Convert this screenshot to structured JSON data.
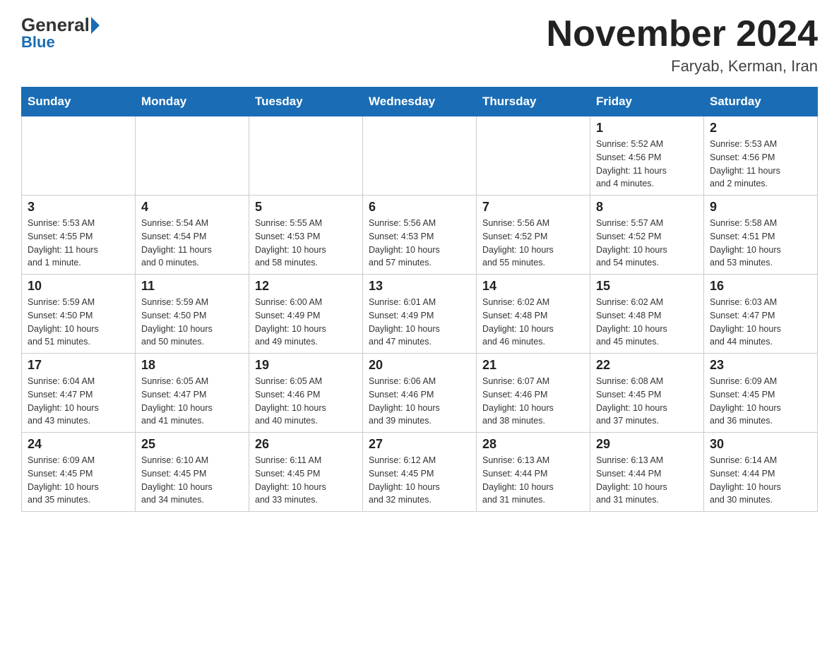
{
  "header": {
    "logo_general": "General",
    "logo_blue": "Blue",
    "title": "November 2024",
    "subtitle": "Faryab, Kerman, Iran"
  },
  "weekdays": [
    "Sunday",
    "Monday",
    "Tuesday",
    "Wednesday",
    "Thursday",
    "Friday",
    "Saturday"
  ],
  "weeks": [
    [
      {
        "day": "",
        "info": ""
      },
      {
        "day": "",
        "info": ""
      },
      {
        "day": "",
        "info": ""
      },
      {
        "day": "",
        "info": ""
      },
      {
        "day": "",
        "info": ""
      },
      {
        "day": "1",
        "info": "Sunrise: 5:52 AM\nSunset: 4:56 PM\nDaylight: 11 hours\nand 4 minutes."
      },
      {
        "day": "2",
        "info": "Sunrise: 5:53 AM\nSunset: 4:56 PM\nDaylight: 11 hours\nand 2 minutes."
      }
    ],
    [
      {
        "day": "3",
        "info": "Sunrise: 5:53 AM\nSunset: 4:55 PM\nDaylight: 11 hours\nand 1 minute."
      },
      {
        "day": "4",
        "info": "Sunrise: 5:54 AM\nSunset: 4:54 PM\nDaylight: 11 hours\nand 0 minutes."
      },
      {
        "day": "5",
        "info": "Sunrise: 5:55 AM\nSunset: 4:53 PM\nDaylight: 10 hours\nand 58 minutes."
      },
      {
        "day": "6",
        "info": "Sunrise: 5:56 AM\nSunset: 4:53 PM\nDaylight: 10 hours\nand 57 minutes."
      },
      {
        "day": "7",
        "info": "Sunrise: 5:56 AM\nSunset: 4:52 PM\nDaylight: 10 hours\nand 55 minutes."
      },
      {
        "day": "8",
        "info": "Sunrise: 5:57 AM\nSunset: 4:52 PM\nDaylight: 10 hours\nand 54 minutes."
      },
      {
        "day": "9",
        "info": "Sunrise: 5:58 AM\nSunset: 4:51 PM\nDaylight: 10 hours\nand 53 minutes."
      }
    ],
    [
      {
        "day": "10",
        "info": "Sunrise: 5:59 AM\nSunset: 4:50 PM\nDaylight: 10 hours\nand 51 minutes."
      },
      {
        "day": "11",
        "info": "Sunrise: 5:59 AM\nSunset: 4:50 PM\nDaylight: 10 hours\nand 50 minutes."
      },
      {
        "day": "12",
        "info": "Sunrise: 6:00 AM\nSunset: 4:49 PM\nDaylight: 10 hours\nand 49 minutes."
      },
      {
        "day": "13",
        "info": "Sunrise: 6:01 AM\nSunset: 4:49 PM\nDaylight: 10 hours\nand 47 minutes."
      },
      {
        "day": "14",
        "info": "Sunrise: 6:02 AM\nSunset: 4:48 PM\nDaylight: 10 hours\nand 46 minutes."
      },
      {
        "day": "15",
        "info": "Sunrise: 6:02 AM\nSunset: 4:48 PM\nDaylight: 10 hours\nand 45 minutes."
      },
      {
        "day": "16",
        "info": "Sunrise: 6:03 AM\nSunset: 4:47 PM\nDaylight: 10 hours\nand 44 minutes."
      }
    ],
    [
      {
        "day": "17",
        "info": "Sunrise: 6:04 AM\nSunset: 4:47 PM\nDaylight: 10 hours\nand 43 minutes."
      },
      {
        "day": "18",
        "info": "Sunrise: 6:05 AM\nSunset: 4:47 PM\nDaylight: 10 hours\nand 41 minutes."
      },
      {
        "day": "19",
        "info": "Sunrise: 6:05 AM\nSunset: 4:46 PM\nDaylight: 10 hours\nand 40 minutes."
      },
      {
        "day": "20",
        "info": "Sunrise: 6:06 AM\nSunset: 4:46 PM\nDaylight: 10 hours\nand 39 minutes."
      },
      {
        "day": "21",
        "info": "Sunrise: 6:07 AM\nSunset: 4:46 PM\nDaylight: 10 hours\nand 38 minutes."
      },
      {
        "day": "22",
        "info": "Sunrise: 6:08 AM\nSunset: 4:45 PM\nDaylight: 10 hours\nand 37 minutes."
      },
      {
        "day": "23",
        "info": "Sunrise: 6:09 AM\nSunset: 4:45 PM\nDaylight: 10 hours\nand 36 minutes."
      }
    ],
    [
      {
        "day": "24",
        "info": "Sunrise: 6:09 AM\nSunset: 4:45 PM\nDaylight: 10 hours\nand 35 minutes."
      },
      {
        "day": "25",
        "info": "Sunrise: 6:10 AM\nSunset: 4:45 PM\nDaylight: 10 hours\nand 34 minutes."
      },
      {
        "day": "26",
        "info": "Sunrise: 6:11 AM\nSunset: 4:45 PM\nDaylight: 10 hours\nand 33 minutes."
      },
      {
        "day": "27",
        "info": "Sunrise: 6:12 AM\nSunset: 4:45 PM\nDaylight: 10 hours\nand 32 minutes."
      },
      {
        "day": "28",
        "info": "Sunrise: 6:13 AM\nSunset: 4:44 PM\nDaylight: 10 hours\nand 31 minutes."
      },
      {
        "day": "29",
        "info": "Sunrise: 6:13 AM\nSunset: 4:44 PM\nDaylight: 10 hours\nand 31 minutes."
      },
      {
        "day": "30",
        "info": "Sunrise: 6:14 AM\nSunset: 4:44 PM\nDaylight: 10 hours\nand 30 minutes."
      }
    ]
  ]
}
